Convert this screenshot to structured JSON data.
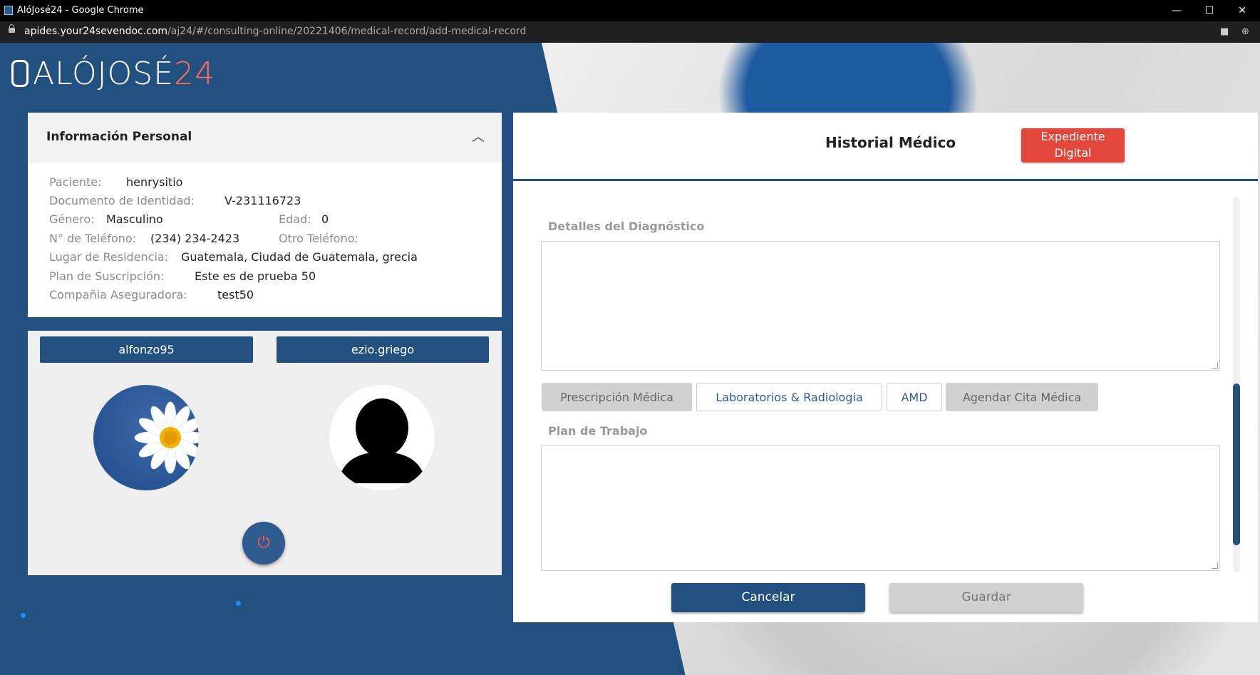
{
  "browser": {
    "window_title": "AlóJosé24 - Google Chrome",
    "url_domain": "apides.your24sevendoc.com",
    "url_path": "/aj24/#/consulting-online/20221406/medical-record/add-medical-record",
    "minimize": "—",
    "maximize": "☐",
    "close": "✕"
  },
  "logo": {
    "text": "ALÓJOSÉ",
    "number": "24"
  },
  "info": {
    "title": "Información Personal",
    "rows": [
      {
        "label": "Paciente:",
        "value": "henrysitio"
      },
      {
        "label": "Documento de Identidad:",
        "value": "V-231116723"
      },
      {
        "label": "Género:",
        "value": "Masculino"
      },
      {
        "label": "Edad:",
        "value": "0"
      },
      {
        "label": "N° de Teléfono:",
        "value": "(234) 234-2423"
      },
      {
        "label": "Otro Teléfono:",
        "value": ""
      },
      {
        "label": "Lugar de Residencia:",
        "value": "Guatemala, Ciudad de Guatemala, grecia"
      },
      {
        "label": "Plan de Suscripción:",
        "value": "Este es de prueba 50"
      },
      {
        "label": "Compañia Aseguradora:",
        "value": "test50"
      }
    ]
  },
  "call": {
    "user1": "alfonzo95",
    "user2": "ezio.griego",
    "power_icon": "power-icon"
  },
  "record": {
    "title": "Historial Médico",
    "expediente": "Expediente Digital",
    "diagnosis_label": "Detalles del Diagnóstico",
    "tabs": [
      "Prescripción Médica",
      "Laboratorios & Radiologia",
      "AMD",
      "Agendar Cita Médica"
    ],
    "plan_label": "Plan de Trabajo",
    "cancel": "Cancelar",
    "save": "Guardar"
  },
  "colors": {
    "primary": "#23517f",
    "accent": "#e2453a"
  }
}
